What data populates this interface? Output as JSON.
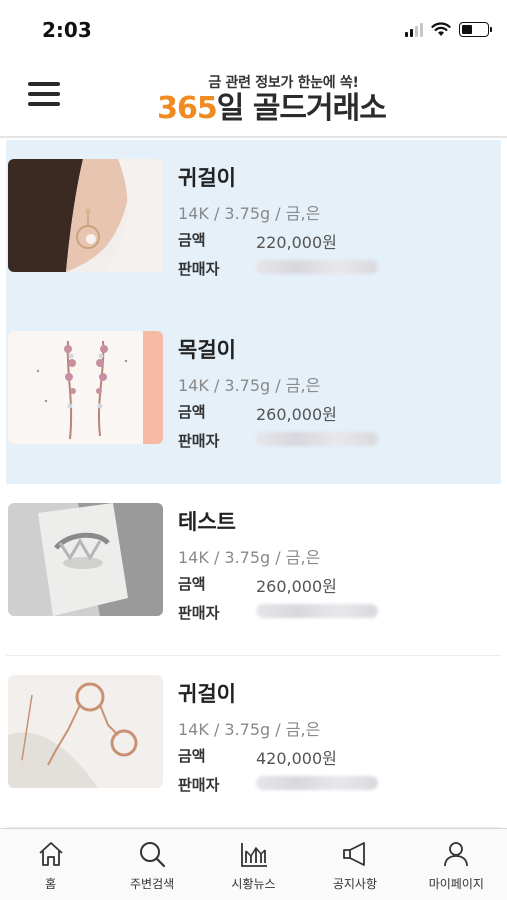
{
  "status": {
    "time": "2:03"
  },
  "header": {
    "tagline": "금 관련 정보가 한눈에 쏙!",
    "brand_number": "365",
    "brand_text": "일 골드거래소"
  },
  "items": [
    {
      "name": "귀걸이",
      "spec": "14K / 3.75g / 금,은",
      "price_label": "금액",
      "price": "220,000원",
      "seller_label": "판매자",
      "highlighted": true
    },
    {
      "name": "목걸이",
      "spec": "14K / 3.75g / 금,은",
      "price_label": "금액",
      "price": "260,000원",
      "seller_label": "판매자",
      "highlighted": true
    },
    {
      "name": "테스트",
      "spec": "14K / 3.75g / 금,은",
      "price_label": "금액",
      "price": "260,000원",
      "seller_label": "판매자",
      "highlighted": false
    },
    {
      "name": "귀걸이",
      "spec": "14K / 3.75g / 금,은",
      "price_label": "금액",
      "price": "420,000원",
      "seller_label": "판매자",
      "highlighted": false
    }
  ],
  "tabs": [
    {
      "label": "홈",
      "icon": "home-icon"
    },
    {
      "label": "주변검색",
      "icon": "search-icon"
    },
    {
      "label": "시황뉴스",
      "icon": "chart-icon"
    },
    {
      "label": "공지사항",
      "icon": "megaphone-icon"
    },
    {
      "label": "마이페이지",
      "icon": "person-icon"
    }
  ],
  "colors": {
    "accent": "#f08a22",
    "highlight_bg": "#e5f0f8"
  }
}
